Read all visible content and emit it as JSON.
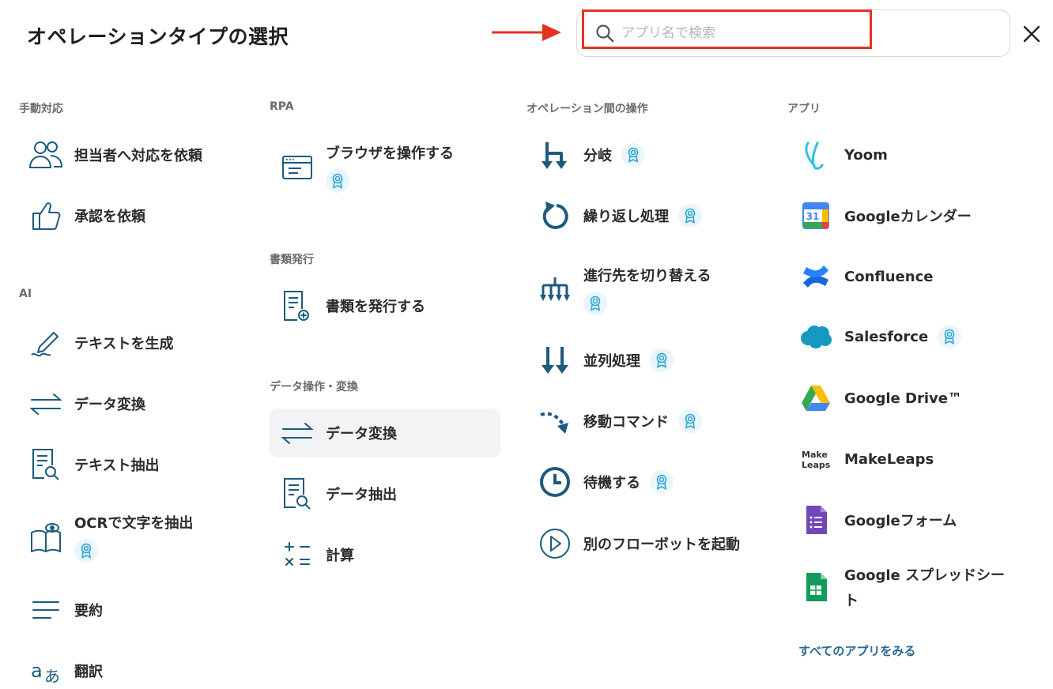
{
  "header": {
    "title": "オペレーションタイプの選択",
    "search_placeholder": "アプリ名で検索",
    "close_icon": "close-icon",
    "highlight_color": "#e53323"
  },
  "sections": {
    "manual": {
      "title": "手動対応",
      "items": [
        {
          "label": "担当者へ対応を依頼",
          "icon": "users-icon"
        },
        {
          "label": "承認を依頼",
          "icon": "thumbs-up-icon"
        }
      ]
    },
    "ai": {
      "title": "AI",
      "items": [
        {
          "label": "テキストを生成",
          "icon": "pen-icon"
        },
        {
          "label": "データ変換",
          "icon": "arrows-exchange-icon"
        },
        {
          "label": "テキスト抽出",
          "icon": "document-search-icon"
        },
        {
          "label": "OCRで文字を抽出",
          "icon": "book-eye-icon",
          "badge": true
        },
        {
          "label": "要約",
          "icon": "lines-icon"
        },
        {
          "label": "翻訳",
          "icon": "translate-icon"
        }
      ]
    },
    "rpa": {
      "title": "RPA",
      "items": [
        {
          "label": "ブラウザを操作する",
          "icon": "browser-icon",
          "badge": true
        }
      ]
    },
    "docs": {
      "title": "書類発行",
      "items": [
        {
          "label": "書類を発行する",
          "icon": "document-add-icon"
        }
      ]
    },
    "data": {
      "title": "データ操作・変換",
      "items": [
        {
          "label": "データ変換",
          "icon": "arrows-exchange-icon",
          "selected": true
        },
        {
          "label": "データ抽出",
          "icon": "document-search-icon"
        },
        {
          "label": "計算",
          "icon": "calculator-icon"
        }
      ]
    },
    "ops": {
      "title": "オペレーション間の操作",
      "items": [
        {
          "label": "分岐",
          "icon": "branch-icon",
          "badge": true
        },
        {
          "label": "繰り返し処理",
          "icon": "loop-icon",
          "badge": true
        },
        {
          "label": "進行先を切り替える",
          "icon": "switch-icon",
          "badge": true
        },
        {
          "label": "並列処理",
          "icon": "parallel-icon",
          "badge": true
        },
        {
          "label": "移動コマンド",
          "icon": "move-icon",
          "badge": true
        },
        {
          "label": "待機する",
          "icon": "clock-icon",
          "badge": true
        },
        {
          "label": "別のフローボットを起動",
          "icon": "play-icon"
        }
      ]
    },
    "apps": {
      "title": "アプリ",
      "items": [
        {
          "label": "Yoom",
          "icon": "yoom-logo-icon"
        },
        {
          "label": "Googleカレンダー",
          "icon": "google-calendar-icon",
          "calendar_day": "31"
        },
        {
          "label": "Confluence",
          "icon": "confluence-icon"
        },
        {
          "label": "Salesforce",
          "icon": "salesforce-icon",
          "badge": true
        },
        {
          "label": "Google Drive™",
          "icon": "google-drive-icon"
        },
        {
          "label": "MakeLeaps",
          "icon": "makeleaps-icon",
          "logo_text_1": "Make",
          "logo_text_2": "Leaps"
        },
        {
          "label": "Googleフォーム",
          "icon": "google-forms-icon"
        },
        {
          "label": "Google スプレッドシート",
          "label_line1": "Google スプレッドシー",
          "label_line2": "ト",
          "icon": "google-sheets-icon"
        }
      ],
      "see_all": "すべてのアプリをみる"
    }
  },
  "colors": {
    "icon_primary": "#1d5b7e",
    "badge_bg": "#eaf6fb",
    "badge_fg": "#2aa8d6",
    "link": "#2b6590"
  }
}
